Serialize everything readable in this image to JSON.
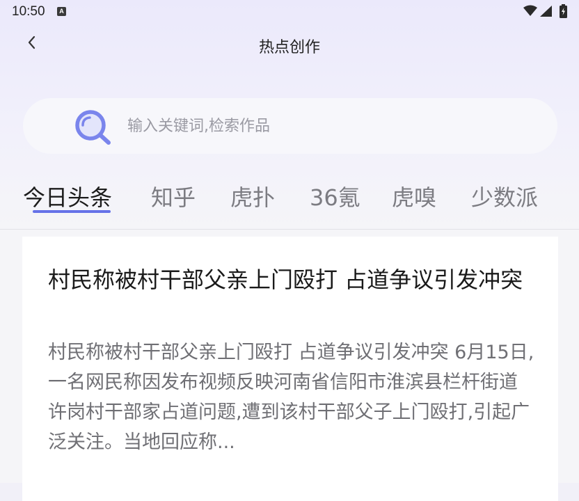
{
  "status_bar": {
    "time": "10:50",
    "notification_badge": "A"
  },
  "header": {
    "title": "热点创作"
  },
  "search": {
    "placeholder": "输入关键词,检索作品",
    "value": ""
  },
  "tabs": [
    {
      "label": "今日头条",
      "active": true
    },
    {
      "label": "知乎",
      "active": false
    },
    {
      "label": "虎扑",
      "active": false
    },
    {
      "label": "36氪",
      "active": false
    },
    {
      "label": "虎嗅",
      "active": false
    },
    {
      "label": "少数派",
      "active": false
    }
  ],
  "articles": [
    {
      "title": "村民称被村干部父亲上门殴打 占道争议引发冲突",
      "summary": "村民称被村干部父亲上门殴打 占道争议引发冲突 6月15日,一名网民称因发布视频反映河南省信阳市淮滨县栏杆街道许岗村干部家占道问题,遭到该村干部父子上门殴打,引起广泛关注。当地回应称..."
    }
  ],
  "colors": {
    "accent": "#6672e8",
    "search_icon": "#7a85ec",
    "background": "#f1f0f8"
  }
}
